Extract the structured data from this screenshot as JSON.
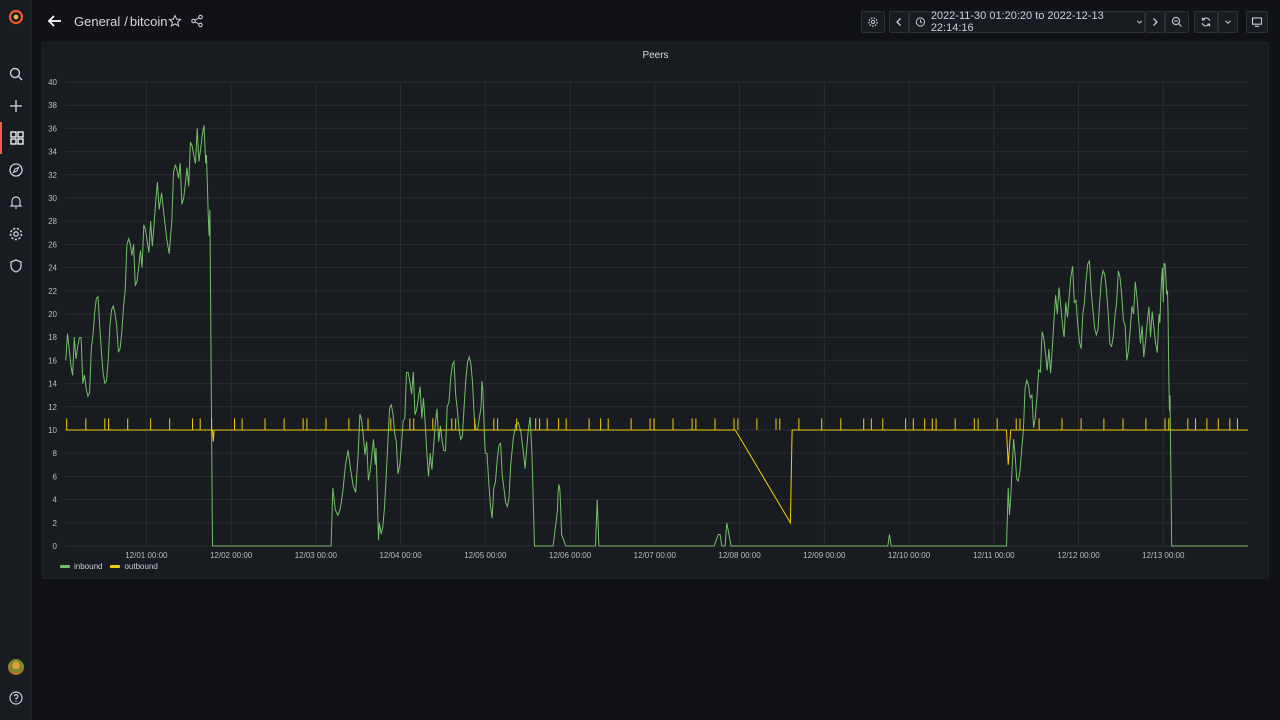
{
  "breadcrumb": {
    "folder": "General",
    "separator": "/",
    "dashboard": "bitcoin"
  },
  "time_range": {
    "label": "2022-11-30 01:20:20 to 2022-12-13 22:14:16"
  },
  "sidemenu": {
    "icons": [
      "grafana-logo-icon",
      "search-icon",
      "plus-icon",
      "dashboards-icon",
      "explore-icon",
      "alert-bell-icon",
      "gear-icon",
      "shield-icon",
      "help-icon"
    ],
    "active": "dashboards-icon"
  },
  "colors": {
    "accent": "#f55f3e",
    "inbound": "#73bf69",
    "outbound": "#f2cc0c"
  },
  "panel": {
    "title": "Peers"
  },
  "chart_data": {
    "type": "line",
    "title": "Peers",
    "xlabel": "",
    "ylabel": "",
    "ylim": [
      0,
      40
    ],
    "y_ticks": [
      "0",
      "2",
      "4",
      "6",
      "8",
      "10",
      "12",
      "14",
      "16",
      "18",
      "20",
      "22",
      "24",
      "26",
      "28",
      "30",
      "32",
      "34",
      "36",
      "38",
      "40"
    ],
    "x_range_days": [
      -0.96,
      13.0
    ],
    "x_ticks": [
      {
        "label": "12/01 00:00",
        "day": 0
      },
      {
        "label": "12/02 00:00",
        "day": 1
      },
      {
        "label": "12/03 00:00",
        "day": 2
      },
      {
        "label": "12/04 00:00",
        "day": 3
      },
      {
        "label": "12/05 00:00",
        "day": 4
      },
      {
        "label": "12/06 00:00",
        "day": 5
      },
      {
        "label": "12/07 00:00",
        "day": 6
      },
      {
        "label": "12/08 00:00",
        "day": 7
      },
      {
        "label": "12/09 00:00",
        "day": 8
      },
      {
        "label": "12/10 00:00",
        "day": 9
      },
      {
        "label": "12/11 00:00",
        "day": 10
      },
      {
        "label": "12/12 00:00",
        "day": 11
      },
      {
        "label": "12/13 00:00",
        "day": 12
      }
    ],
    "grid": true,
    "legend_position": "bottom-left",
    "series": [
      {
        "name": "inbound",
        "color": "#73bf69",
        "points": [
          [
            -0.95,
            16
          ],
          [
            -0.85,
            18
          ],
          [
            -0.75,
            14
          ],
          [
            -0.65,
            17
          ],
          [
            -0.55,
            19
          ],
          [
            -0.45,
            16
          ],
          [
            -0.35,
            19
          ],
          [
            -0.25,
            22
          ],
          [
            -0.15,
            26
          ],
          [
            -0.05,
            24
          ],
          [
            0.05,
            28
          ],
          [
            0.15,
            29
          ],
          [
            0.3,
            28
          ],
          [
            0.4,
            33
          ],
          [
            0.5,
            31
          ],
          [
            0.6,
            36
          ],
          [
            0.7,
            33
          ],
          [
            0.75,
            29
          ],
          [
            0.78,
            0
          ],
          [
            1.0,
            0
          ],
          [
            1.5,
            0
          ],
          [
            2.0,
            0
          ],
          [
            2.18,
            0
          ],
          [
            2.2,
            5
          ],
          [
            2.35,
            7
          ],
          [
            2.5,
            8
          ],
          [
            2.6,
            9
          ],
          [
            2.7,
            7
          ],
          [
            2.75,
            2
          ],
          [
            2.85,
            9
          ],
          [
            2.95,
            9
          ],
          [
            3.05,
            11
          ],
          [
            3.15,
            15
          ],
          [
            3.25,
            11
          ],
          [
            3.35,
            8
          ],
          [
            3.45,
            9
          ],
          [
            3.55,
            12
          ],
          [
            3.65,
            13
          ],
          [
            3.75,
            12
          ],
          [
            3.85,
            14
          ],
          [
            3.95,
            12
          ],
          [
            4.0,
            8
          ],
          [
            4.1,
            5
          ],
          [
            4.2,
            6
          ],
          [
            4.3,
            7
          ],
          [
            4.45,
            8
          ],
          [
            4.55,
            8
          ],
          [
            4.58,
            0
          ],
          [
            4.7,
            0
          ],
          [
            4.8,
            0
          ],
          [
            4.85,
            3
          ],
          [
            4.9,
            1
          ],
          [
            4.95,
            0
          ],
          [
            5.3,
            0
          ],
          [
            5.32,
            4
          ],
          [
            5.34,
            0
          ],
          [
            6.0,
            0
          ],
          [
            6.7,
            0
          ],
          [
            6.75,
            1
          ],
          [
            6.85,
            2
          ],
          [
            6.9,
            0
          ],
          [
            7.0,
            0
          ],
          [
            7.5,
            0
          ],
          [
            8.0,
            0
          ],
          [
            8.75,
            0
          ],
          [
            8.77,
            1
          ],
          [
            8.79,
            0
          ],
          [
            9.5,
            0
          ],
          [
            10.0,
            0
          ],
          [
            10.15,
            0
          ],
          [
            10.17,
            5
          ],
          [
            10.25,
            8
          ],
          [
            10.35,
            10
          ],
          [
            10.45,
            13
          ],
          [
            10.55,
            15
          ],
          [
            10.65,
            17
          ],
          [
            10.75,
            20
          ],
          [
            10.85,
            21
          ],
          [
            10.95,
            21
          ],
          [
            11.05,
            20
          ],
          [
            11.15,
            22
          ],
          [
            11.25,
            21
          ],
          [
            11.35,
            20
          ],
          [
            11.45,
            21
          ],
          [
            11.55,
            19
          ],
          [
            11.65,
            20
          ],
          [
            11.75,
            19
          ],
          [
            11.85,
            18
          ],
          [
            11.95,
            20
          ],
          [
            12.0,
            21
          ],
          [
            12.05,
            22
          ],
          [
            12.08,
            13
          ],
          [
            12.1,
            0
          ],
          [
            12.5,
            0
          ],
          [
            13.0,
            0
          ]
        ]
      },
      {
        "name": "outbound",
        "color": "#f2cc0c",
        "baseline": 10,
        "points": [
          [
            -0.95,
            10
          ],
          [
            0.78,
            10
          ],
          [
            0.79,
            9
          ],
          [
            0.8,
            10
          ],
          [
            2.0,
            10
          ],
          [
            3.0,
            10
          ],
          [
            4.0,
            10
          ],
          [
            5.0,
            10
          ],
          [
            6.0,
            10
          ],
          [
            6.95,
            10
          ],
          [
            7.6,
            2
          ],
          [
            7.62,
            10
          ],
          [
            8.0,
            10
          ],
          [
            9.0,
            10
          ],
          [
            10.0,
            10
          ],
          [
            10.15,
            10
          ],
          [
            10.17,
            7
          ],
          [
            10.2,
            10
          ],
          [
            11.0,
            10
          ],
          [
            12.0,
            10
          ],
          [
            13.0,
            10
          ]
        ]
      }
    ]
  },
  "legend": {
    "inbound": "inbound",
    "outbound": "outbound"
  }
}
